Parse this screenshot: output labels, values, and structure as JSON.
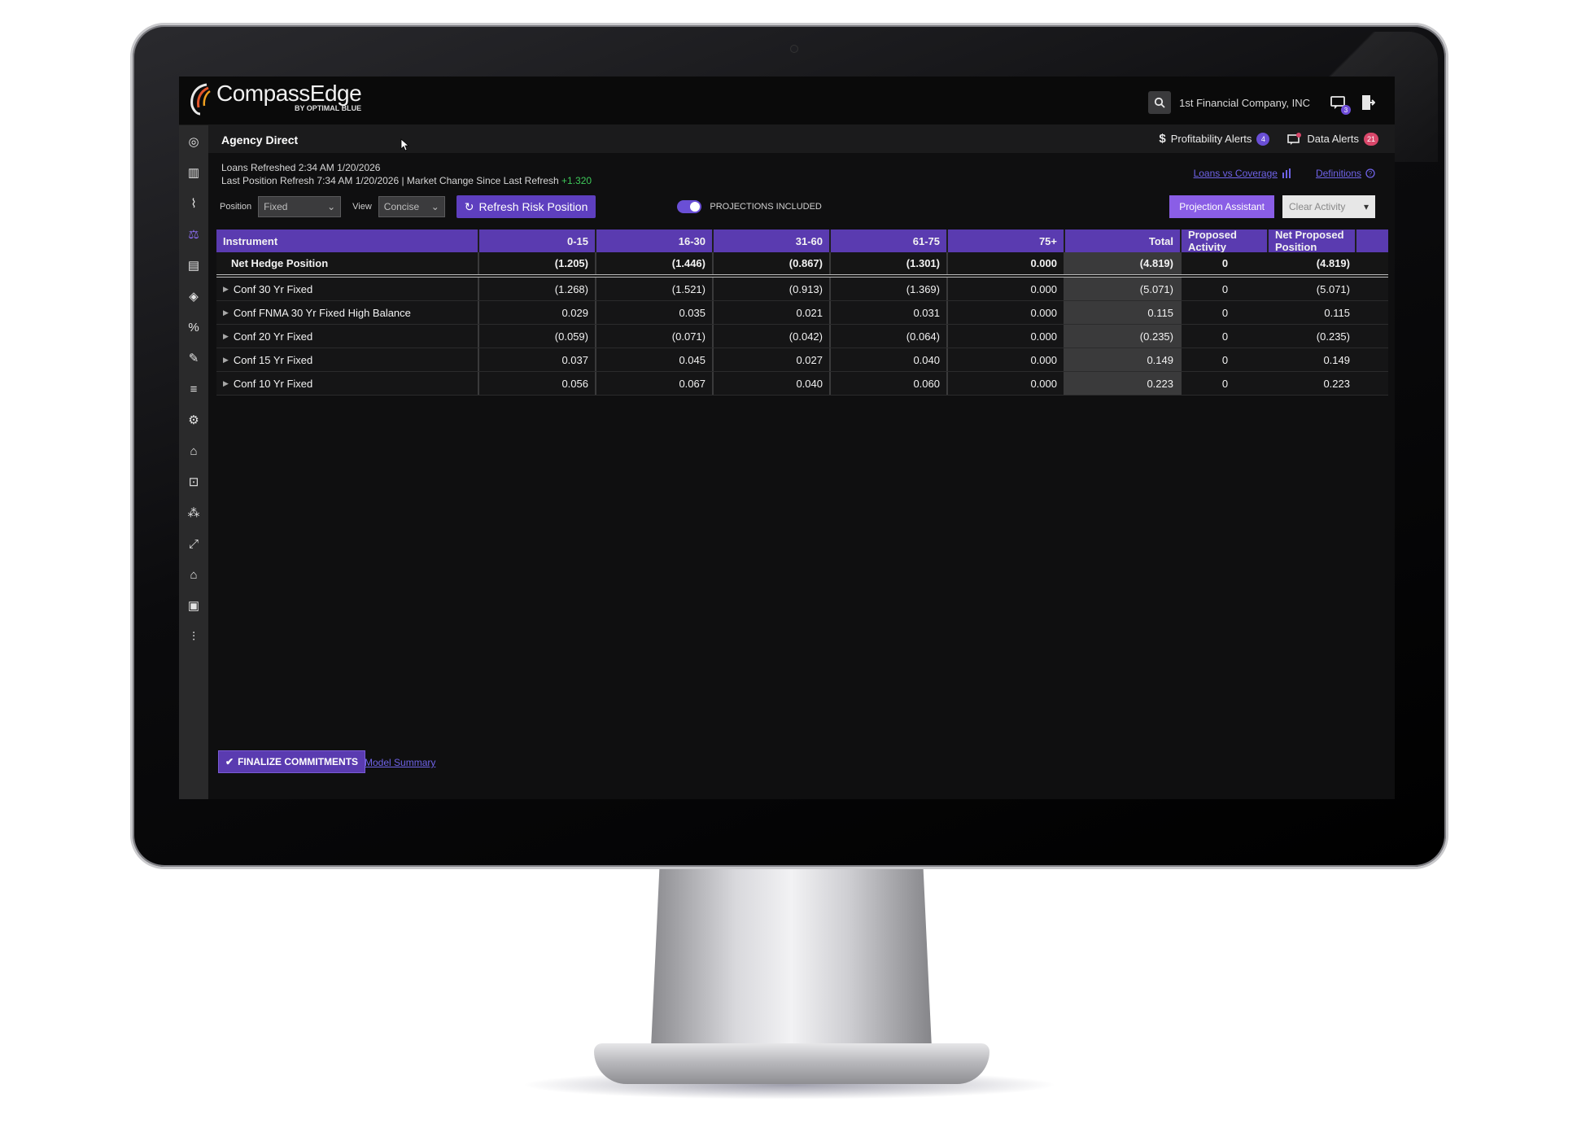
{
  "app": {
    "logo_name": "CompassEdge",
    "logo_sub": "BY OPTIMAL BLUE",
    "company": "1st Financial Company, INC",
    "messages_badge": "3"
  },
  "page": {
    "title": "Agency Direct",
    "profitability_alerts": {
      "label": "Profitability Alerts",
      "count": "4"
    },
    "data_alerts": {
      "label": "Data Alerts",
      "count": "21"
    },
    "loans_refreshed": "Loans Refreshed 2:34 AM 1/20/2026",
    "last_position_refresh": "Last Position Refresh 7:34 AM 1/20/2026 | Market Change Since Last Refresh",
    "market_change": "+1.320",
    "loans_vs_coverage": "Loans vs Coverage",
    "definitions": "Definitions"
  },
  "controls": {
    "position_label": "Position",
    "position_value": "Fixed",
    "view_label": "View",
    "view_value": "Concise",
    "refresh_button": "Refresh Risk Position",
    "projections_label": "PROJECTIONS INCLUDED",
    "projection_assistant": "Projection Assistant",
    "clear_activity": "Clear Activity"
  },
  "table": {
    "headers": [
      "Instrument",
      "0-15",
      "16-30",
      "31-60",
      "61-75",
      "75+",
      "Total",
      "Proposed Activity",
      "Net Proposed Position"
    ],
    "net_row": [
      "Net Hedge Position",
      "(1.205)",
      "(1.446)",
      "(0.867)",
      "(1.301)",
      "0.000",
      "(4.819)",
      "0",
      "(4.819)"
    ],
    "rows": [
      [
        "Conf 30 Yr Fixed",
        "(1.268)",
        "(1.521)",
        "(0.913)",
        "(1.369)",
        "0.000",
        "(5.071)",
        "0",
        "(5.071)"
      ],
      [
        "Conf FNMA 30 Yr Fixed High Balance",
        "0.029",
        "0.035",
        "0.021",
        "0.031",
        "0.000",
        "0.115",
        "0",
        "0.115"
      ],
      [
        "Conf 20 Yr Fixed",
        "(0.059)",
        "(0.071)",
        "(0.042)",
        "(0.064)",
        "0.000",
        "(0.235)",
        "0",
        "(0.235)"
      ],
      [
        "Conf 15 Yr Fixed",
        "0.037",
        "0.045",
        "0.027",
        "0.040",
        "0.000",
        "0.149",
        "0",
        "0.149"
      ],
      [
        "Conf 10 Yr Fixed",
        "0.056",
        "0.067",
        "0.040",
        "0.060",
        "0.000",
        "0.223",
        "0",
        "0.223"
      ]
    ]
  },
  "footer": {
    "finalize": "FINALIZE COMMITMENTS",
    "model_summary": "Model Summary"
  },
  "colors": {
    "accent": "#5a3bb0",
    "link": "#6f63e8",
    "positive_change": "#3ec95a"
  }
}
